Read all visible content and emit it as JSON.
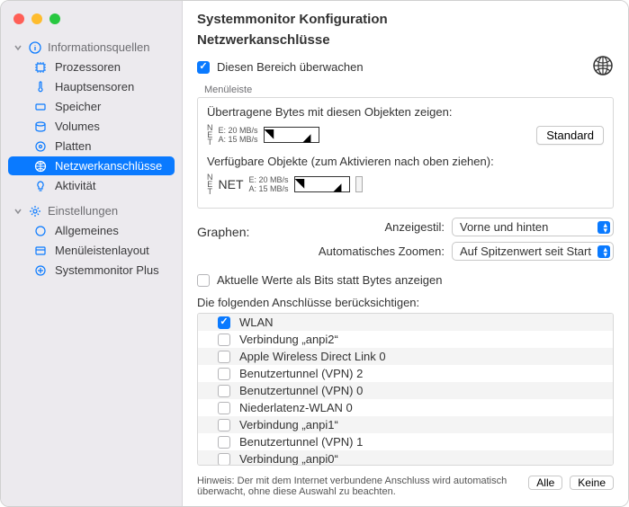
{
  "window_title": "Systemmonitor Konfiguration",
  "page_title": "Netzwerkanschlüsse",
  "sidebar": {
    "group1": {
      "label": "Informationsquellen",
      "items": [
        "Prozessoren",
        "Hauptsensoren",
        "Speicher",
        "Volumes",
        "Platten",
        "Netzwerkanschlüsse",
        "Aktivität"
      ]
    },
    "group2": {
      "label": "Einstellungen",
      "items": [
        "Allgemeines",
        "Menüleistenlayout",
        "Systemmonitor Plus"
      ]
    }
  },
  "monitor": {
    "label": "Diesen Bereich überwachen"
  },
  "menubar_label": "Menüleiste",
  "shown_objects": {
    "label": "Übertragene Bytes mit diesen Objekten zeigen:",
    "line1": "E:  20 MB/s",
    "line2": "A:  15 MB/s",
    "default_btn": "Standard"
  },
  "available_objects": {
    "label": "Verfügbare Objekte (zum Aktivieren nach oben ziehen):",
    "net_label": "NET",
    "line1": "E:  20 MB/s",
    "line2": "A:  15 MB/s"
  },
  "graphen": {
    "label": "Graphen:",
    "display_style_label": "Anzeigestil:",
    "display_style_value": "Vorne und hinten",
    "zoom_label": "Automatisches Zoomen:",
    "zoom_value": "Auf Spitzenwert seit Start"
  },
  "bits_checkbox": {
    "label": "Aktuelle Werte als Bits statt Bytes anzeigen"
  },
  "ports_label": "Die folgenden Anschlüsse berücksichtigen:",
  "ports": [
    {
      "label": "WLAN",
      "checked": true
    },
    {
      "label": "Verbindung „anpi2“",
      "checked": false
    },
    {
      "label": "Apple Wireless Direct Link 0",
      "checked": false
    },
    {
      "label": "Benutzertunnel (VPN) 2",
      "checked": false
    },
    {
      "label": "Benutzertunnel (VPN) 0",
      "checked": false
    },
    {
      "label": "Niederlatenz-WLAN 0",
      "checked": false
    },
    {
      "label": "Verbindung „anpi1“",
      "checked": false
    },
    {
      "label": "Benutzertunnel (VPN) 1",
      "checked": false
    },
    {
      "label": "Verbindung „anpi0“",
      "checked": false
    }
  ],
  "footer": {
    "hint": "Hinweis: Der mit dem Internet verbundene Anschluss wird automatisch überwacht, ohne diese Auswahl zu beachten.",
    "all_btn": "Alle",
    "none_btn": "Keine"
  }
}
